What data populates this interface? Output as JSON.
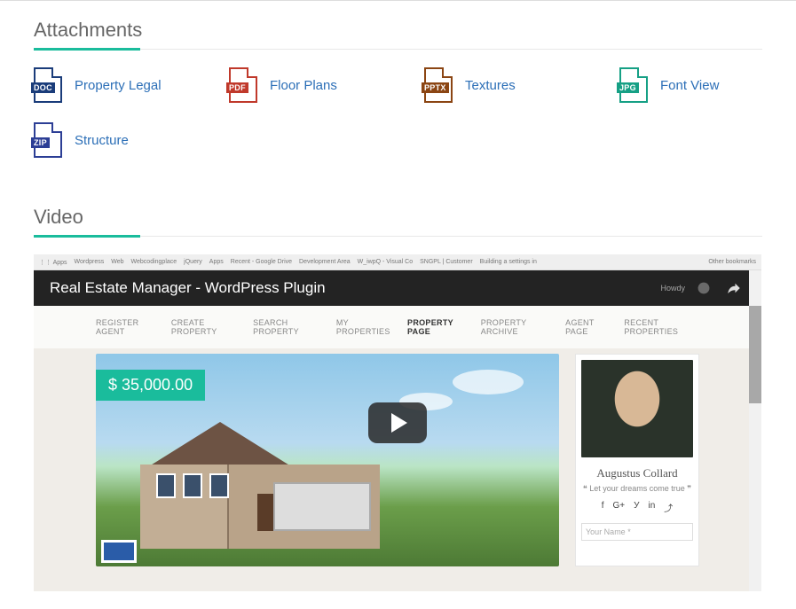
{
  "sections": {
    "attachments_title": "Attachments",
    "video_title": "Video"
  },
  "attachments": [
    {
      "type": "DOC",
      "label": "Property Legal"
    },
    {
      "type": "PDF",
      "label": "Floor Plans"
    },
    {
      "type": "PPTX",
      "label": "Textures"
    },
    {
      "type": "JPG",
      "label": "Font View"
    },
    {
      "type": "ZIP",
      "label": "Structure"
    }
  ],
  "video": {
    "title": "Real Estate Manager - WordPress Plugin",
    "howdy": "Howdy",
    "tabbar": {
      "apps": "Apps",
      "items": [
        "Wordpress",
        "Web",
        "Webcodingplace",
        "jQuery",
        "Apps",
        "Recent - Google Drive",
        "Development Area",
        "W_iwpQ - Visual Co",
        "SNGPL | Customer",
        "Building a settings in",
        "Other bookmarks"
      ]
    },
    "nav": [
      "REGISTER AGENT",
      "CREATE PROPERTY",
      "SEARCH PROPERTY",
      "MY PROPERTIES",
      "PROPERTY PAGE",
      "PROPERTY ARCHIVE",
      "AGENT PAGE",
      "RECENT PROPERTIES"
    ],
    "nav_active": "PROPERTY PAGE",
    "price": "$ 35,000.00",
    "agent": {
      "name": "Augustus Collard",
      "tagline": "❝ Let your dreams come true ❞",
      "social": [
        "f",
        "G+",
        "У",
        "in",
        "⤴"
      ],
      "name_placeholder": "Your Name *"
    }
  }
}
